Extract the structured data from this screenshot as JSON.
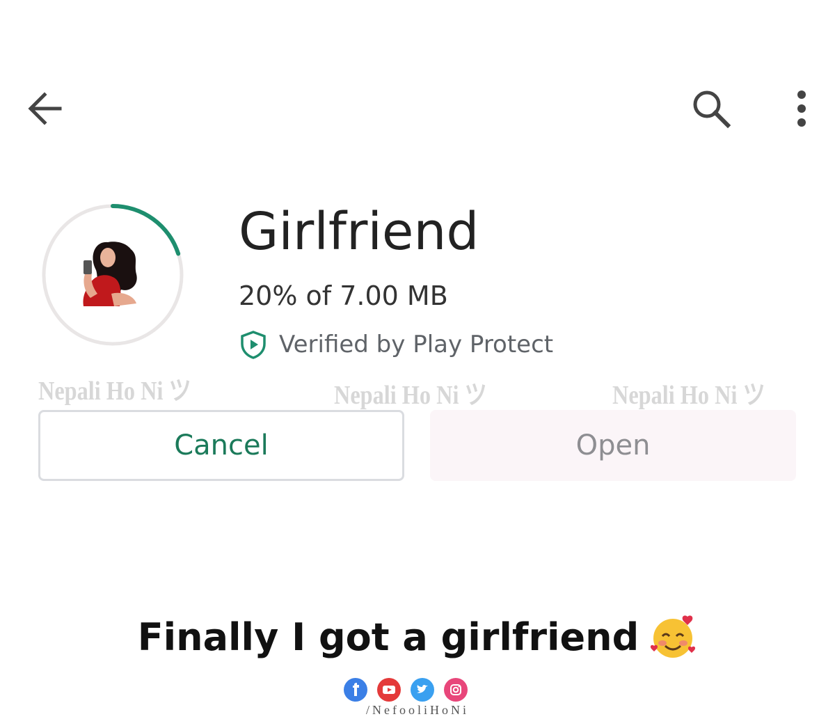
{
  "toolbar": {
    "back_icon": "arrow-left-icon",
    "search_icon": "search-icon",
    "more_icon": "more-vert-icon"
  },
  "app": {
    "title": "Girlfriend",
    "download_status": "20% of 7.00 MB",
    "progress_fraction": 0.2,
    "verified_text": "Verified by Play Protect",
    "accent_color": "#1e8e6e"
  },
  "watermark": {
    "text": "Nepali Ho Ni ツ"
  },
  "buttons": {
    "cancel_label": "Cancel",
    "open_label": "Open"
  },
  "caption": {
    "text": "Finally I got a girlfriend"
  },
  "footer": {
    "social_icons": [
      "facebook-icon",
      "youtube-icon",
      "twitter-icon",
      "instagram-icon"
    ],
    "handle": "/NefooliHoNi"
  }
}
